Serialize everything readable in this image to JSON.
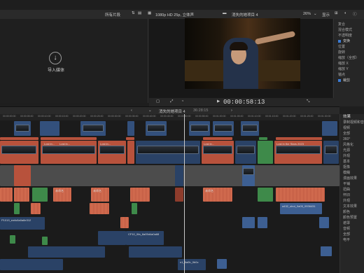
{
  "toolbar": {
    "all_clips": "所有片段",
    "format": "1080p HD 25p, 立体声",
    "project_title": "消失的她项目 4",
    "zoom": "26%",
    "display": "显示"
  },
  "browser": {
    "import_label": "导入媒体"
  },
  "timecode": "00:00:58:13",
  "inspector": {
    "items": [
      {
        "label": "复合",
        "checked": false
      },
      {
        "label": "混合模式",
        "checked": false
      },
      {
        "label": "不透明度",
        "checked": false
      },
      {
        "label": "变换",
        "checked": true
      },
      {
        "label": "位置",
        "checked": false
      },
      {
        "label": "旋转",
        "checked": false
      },
      {
        "label": "缩放（全部）",
        "checked": false
      },
      {
        "label": "缩放 X",
        "checked": false
      },
      {
        "label": "缩放 Y",
        "checked": false
      },
      {
        "label": "锚点",
        "checked": false
      },
      {
        "label": "裁剪",
        "checked": true
      }
    ]
  },
  "timeline_header": {
    "project_title": "消失的她项目 4",
    "duration": "36:28:15"
  },
  "ruler_ticks": [
    "00:00:00:00",
    "00:00:05:00",
    "00:00:10:00",
    "00:00:15:00",
    "00:00:20:00",
    "00:00:25:00",
    "00:00:30:00",
    "00:00:35:00",
    "00:00:40:00",
    "00:00:45:00",
    "00:00:50:00",
    "00:00:55:00",
    "00:01:00:00",
    "00:01:05:00",
    "00:01:10:00",
    "00:01:15:00",
    "00:01:20:00",
    "00:01:25:00",
    "00:01:30:00"
  ],
  "effects": {
    "title": "效果",
    "items": [
      "录制视频和音频",
      "视频",
      "全部",
      "360°",
      "风格化",
      "光源",
      "外观",
      "基本",
      "抠像",
      "模糊",
      "漫画效果",
      "平铺",
      "扭曲",
      "怀旧",
      "外观",
      "文本效果",
      "颜色",
      "颜色预置",
      "遮罩",
      "音频",
      "全部",
      "电平"
    ]
  },
  "clip_labels": {
    "lost_in_stars": "Lost in...",
    "lost_in_stars_full": "Lost in the Stars 2023",
    "cn_clip": "未命名",
    "audio_clip": "未命名",
    "file_a": "a432_shot_0a05_0936431",
    "file_b": "P1019_ewfo8a0a8e312",
    "file_c": "CF10_0fa_8a05d4a0a68",
    "file_d": "n1_8a0b_0b0c"
  }
}
